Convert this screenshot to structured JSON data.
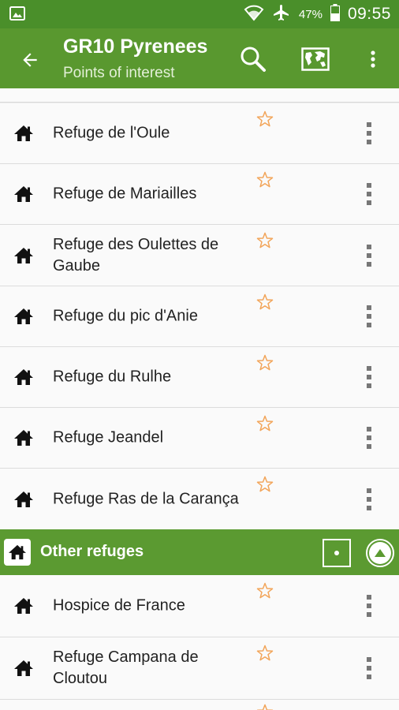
{
  "status_bar": {
    "battery": "47%",
    "time": "09:55"
  },
  "app_bar": {
    "title": "GR10 Pyrenees",
    "subtitle": "Points of interest"
  },
  "section_refuges": {
    "items": [
      {
        "label": "Refuge de l'Oule"
      },
      {
        "label": "Refuge de Mariailles"
      },
      {
        "label": "Refuge des Oulettes de Gaube"
      },
      {
        "label": "Refuge du pic d'Anie"
      },
      {
        "label": "Refuge du Rulhe"
      },
      {
        "label": "Refuge Jeandel"
      },
      {
        "label": "Refuge Ras de la Carança"
      }
    ]
  },
  "section_other": {
    "title": "Other refuges",
    "items": [
      {
        "label": "Hospice de France"
      },
      {
        "label": "Refuge Campana de Cloutou"
      }
    ]
  },
  "colors": {
    "status_bar": "#4a8f2a",
    "app_bar": "#59982f",
    "section_header": "#5b9a31",
    "star_outline": "#f2a55a",
    "row_background": "#fafafa"
  },
  "icons": {
    "back": "arrow-left-icon",
    "search": "search-icon",
    "map": "map-icon",
    "overflow": "more-vert-icon",
    "poi": "house-icon",
    "favorite": "star-outline-icon"
  }
}
